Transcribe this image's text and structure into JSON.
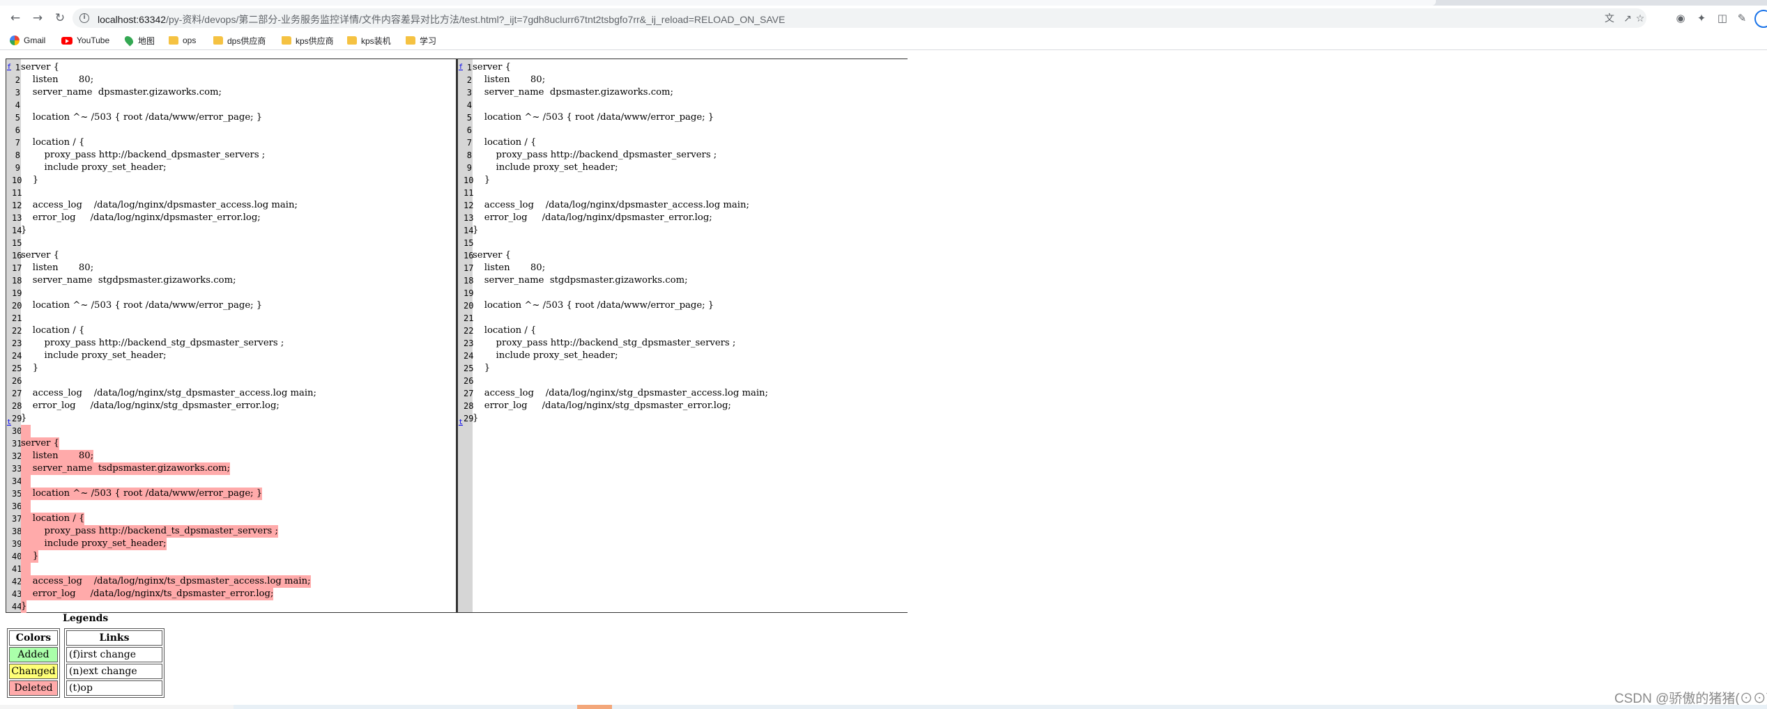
{
  "browser": {
    "url_host": "localhost:63342",
    "url_rest": "/py-资料/devops/第二部分-业务服务监控详情/文件内容差异对比方法/test.html?_ijt=7gdh8uclurr67tnt2tsbgfo7rr&_ij_reload=RELOAD_ON_SAVE",
    "back_icon": "back-arrow-icon",
    "forward_icon": "forward-arrow-icon",
    "reload_icon": "reload-icon"
  },
  "bookmarks": [
    {
      "label": "Gmail",
      "icon": "google-icon"
    },
    {
      "label": "YouTube",
      "icon": "youtube-icon"
    },
    {
      "label": "地图",
      "icon": "maps-icon"
    },
    {
      "label": "ops",
      "icon": "folder-icon"
    },
    {
      "label": "dps供应商",
      "icon": "folder-icon"
    },
    {
      "label": "kps供应商",
      "icon": "folder-icon"
    },
    {
      "label": "kps装机",
      "icon": "folder-icon"
    },
    {
      "label": "学习",
      "icon": "folder-icon"
    }
  ],
  "diff": {
    "left": [
      {
        "n": "1",
        "t": "server {",
        "s": ""
      },
      {
        "n": "2",
        "t": "    listen       80;",
        "s": ""
      },
      {
        "n": "3",
        "t": "    server_name  dpsmaster.gizaworks.com;",
        "s": ""
      },
      {
        "n": "4",
        "t": "",
        "s": ""
      },
      {
        "n": "5",
        "t": "    location ^~ /503 { root /data/www/error_page; }",
        "s": ""
      },
      {
        "n": "6",
        "t": "",
        "s": ""
      },
      {
        "n": "7",
        "t": "    location / {",
        "s": ""
      },
      {
        "n": "8",
        "t": "        proxy_pass http://backend_dpsmaster_servers ;",
        "s": ""
      },
      {
        "n": "9",
        "t": "        include proxy_set_header;",
        "s": ""
      },
      {
        "n": "10",
        "t": "    }",
        "s": ""
      },
      {
        "n": "11",
        "t": "",
        "s": ""
      },
      {
        "n": "12",
        "t": "    access_log    /data/log/nginx/dpsmaster_access.log main;",
        "s": ""
      },
      {
        "n": "13",
        "t": "    error_log     /data/log/nginx/dpsmaster_error.log;",
        "s": ""
      },
      {
        "n": "14",
        "t": "}",
        "s": ""
      },
      {
        "n": "15",
        "t": "",
        "s": ""
      },
      {
        "n": "16",
        "t": "server {",
        "s": ""
      },
      {
        "n": "17",
        "t": "    listen       80;",
        "s": ""
      },
      {
        "n": "18",
        "t": "    server_name  stgdpsmaster.gizaworks.com;",
        "s": ""
      },
      {
        "n": "19",
        "t": "",
        "s": ""
      },
      {
        "n": "20",
        "t": "    location ^~ /503 { root /data/www/error_page; }",
        "s": ""
      },
      {
        "n": "21",
        "t": "",
        "s": ""
      },
      {
        "n": "22",
        "t": "    location / {",
        "s": ""
      },
      {
        "n": "23",
        "t": "        proxy_pass http://backend_stg_dpsmaster_servers ;",
        "s": ""
      },
      {
        "n": "24",
        "t": "        include proxy_set_header;",
        "s": ""
      },
      {
        "n": "25",
        "t": "    }",
        "s": ""
      },
      {
        "n": "26",
        "t": "",
        "s": ""
      },
      {
        "n": "27",
        "t": "    access_log    /data/log/nginx/stg_dpsmaster_access.log main;",
        "s": ""
      },
      {
        "n": "28",
        "t": "    error_log     /data/log/nginx/stg_dpsmaster_error.log;",
        "s": ""
      },
      {
        "n": "29",
        "t": "}",
        "s": ""
      },
      {
        "n": "30",
        "t": "",
        "s": "del"
      },
      {
        "n": "31",
        "t": "server {",
        "s": "del"
      },
      {
        "n": "32",
        "t": "    listen       80;",
        "s": "del"
      },
      {
        "n": "33",
        "t": "    server_name  tsdpsmaster.gizaworks.com;",
        "s": "del"
      },
      {
        "n": "34",
        "t": "",
        "s": "del"
      },
      {
        "n": "35",
        "t": "    location ^~ /503 { root /data/www/error_page; }",
        "s": "del"
      },
      {
        "n": "36",
        "t": "",
        "s": "del"
      },
      {
        "n": "37",
        "t": "    location / {",
        "s": "del"
      },
      {
        "n": "38",
        "t": "        proxy_pass http://backend_ts_dpsmaster_servers ;",
        "s": "del"
      },
      {
        "n": "39",
        "t": "        include proxy_set_header;",
        "s": "del"
      },
      {
        "n": "40",
        "t": "    }",
        "s": "del"
      },
      {
        "n": "41",
        "t": "",
        "s": "del"
      },
      {
        "n": "42",
        "t": "    access_log    /data/log/nginx/ts_dpsmaster_access.log main;",
        "s": "del"
      },
      {
        "n": "43",
        "t": "    error_log     /data/log/nginx/ts_dpsmaster_error.log;",
        "s": "del"
      },
      {
        "n": "44",
        "t": "}",
        "s": "del"
      }
    ],
    "right": [
      {
        "n": "1",
        "t": "server {",
        "s": ""
      },
      {
        "n": "2",
        "t": "    listen       80;",
        "s": ""
      },
      {
        "n": "3",
        "t": "    server_name  dpsmaster.gizaworks.com;",
        "s": ""
      },
      {
        "n": "4",
        "t": "",
        "s": ""
      },
      {
        "n": "5",
        "t": "    location ^~ /503 { root /data/www/error_page; }",
        "s": ""
      },
      {
        "n": "6",
        "t": "",
        "s": ""
      },
      {
        "n": "7",
        "t": "    location / {",
        "s": ""
      },
      {
        "n": "8",
        "t": "        proxy_pass http://backend_dpsmaster_servers ;",
        "s": ""
      },
      {
        "n": "9",
        "t": "        include proxy_set_header;",
        "s": ""
      },
      {
        "n": "10",
        "t": "    }",
        "s": ""
      },
      {
        "n": "11",
        "t": "",
        "s": ""
      },
      {
        "n": "12",
        "t": "    access_log    /data/log/nginx/dpsmaster_access.log main;",
        "s": ""
      },
      {
        "n": "13",
        "t": "    error_log     /data/log/nginx/dpsmaster_error.log;",
        "s": ""
      },
      {
        "n": "14",
        "t": "}",
        "s": ""
      },
      {
        "n": "15",
        "t": "",
        "s": ""
      },
      {
        "n": "16",
        "t": "server {",
        "s": ""
      },
      {
        "n": "17",
        "t": "    listen       80;",
        "s": ""
      },
      {
        "n": "18",
        "t": "    server_name  stgdpsmaster.gizaworks.com;",
        "s": ""
      },
      {
        "n": "19",
        "t": "",
        "s": ""
      },
      {
        "n": "20",
        "t": "    location ^~ /503 { root /data/www/error_page; }",
        "s": ""
      },
      {
        "n": "21",
        "t": "",
        "s": ""
      },
      {
        "n": "22",
        "t": "    location / {",
        "s": ""
      },
      {
        "n": "23",
        "t": "        proxy_pass http://backend_stg_dpsmaster_servers ;",
        "s": ""
      },
      {
        "n": "24",
        "t": "        include proxy_set_header;",
        "s": ""
      },
      {
        "n": "25",
        "t": "    }",
        "s": ""
      },
      {
        "n": "26",
        "t": "",
        "s": ""
      },
      {
        "n": "27",
        "t": "    access_log    /data/log/nginx/stg_dpsmaster_access.log main;",
        "s": ""
      },
      {
        "n": "28",
        "t": "    error_log     /data/log/nginx/stg_dpsmaster_error.log;",
        "s": ""
      },
      {
        "n": "29",
        "t": "}",
        "s": ""
      }
    ],
    "nav_links": {
      "first": "f",
      "top": "t"
    }
  },
  "legend": {
    "title": "Legends",
    "colors_header": "Colors",
    "links_header": "Links",
    "added": "Added",
    "changed": "Changed",
    "deleted": "Deleted",
    "added_color": "#aaffaa",
    "changed_color": "#ffff77",
    "deleted_color": "#ffaaaa",
    "first_change": "(f)irst change",
    "next_change": "(n)ext change",
    "top": "(t)op"
  },
  "watermark": "CSDN @骄傲的猪猪(⊙⊙)"
}
